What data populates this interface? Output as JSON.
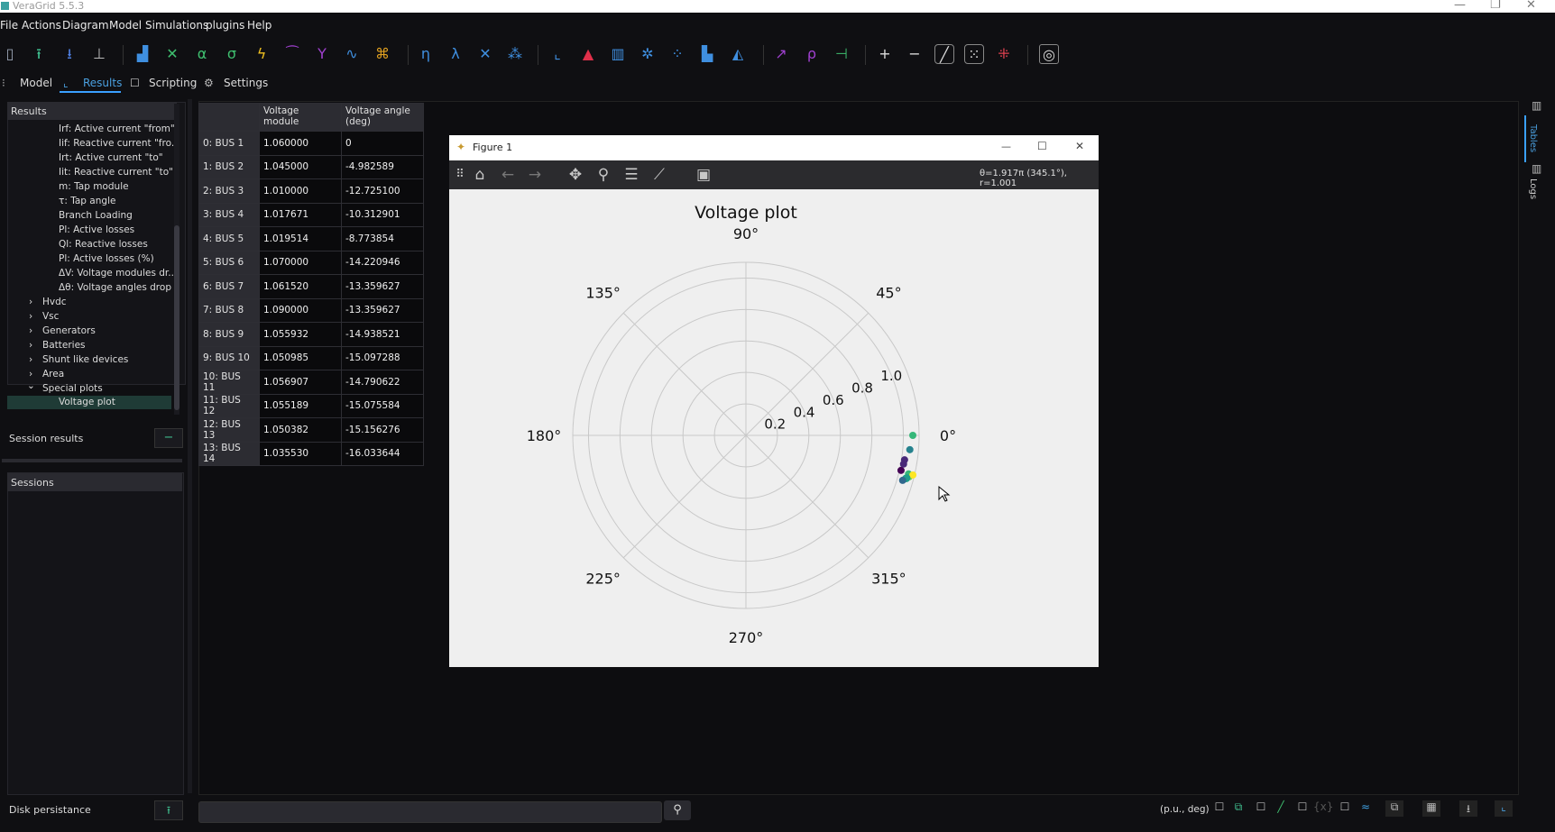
{
  "window": {
    "title": "VeraGrid 5.5.3"
  },
  "menu": [
    "File",
    "Actions",
    "Diagram",
    "Model",
    "Simulations",
    "plugins",
    "Help"
  ],
  "toolbar": {
    "icons": [
      "new-file-icon",
      "open-file-icon",
      "save-file-icon",
      "export-icon",
      "power-flow-icon",
      "short-circuit-icon",
      "alpha-icon",
      "sigma-icon",
      "lightning-icon",
      "curve-icon",
      "y-icon",
      "wave-icon",
      "bug-icon",
      "eta-icon",
      "lambda-icon",
      "network-icon",
      "cluster-icon",
      "chart-axis-icon",
      "triangle-icon",
      "bars-icon",
      "sparkle-icon",
      "scatter-icon",
      "bar-chart-icon",
      "area-chart-icon",
      "tool-1-icon",
      "tool-2-icon",
      "tool-3-icon",
      "zoom-in-icon",
      "zoom-out-icon",
      "slash-icon",
      "select-icon",
      "clear-icon",
      "screenshot-icon"
    ],
    "zoom_in": "+",
    "zoom_out": "−"
  },
  "tabs": [
    {
      "label": "Model",
      "icon": "model-icon"
    },
    {
      "label": "Results",
      "icon": "results-icon",
      "active": true
    },
    {
      "label": "Scripting",
      "icon": "scripting-icon"
    },
    {
      "label": "Settings",
      "icon": "gear-icon"
    }
  ],
  "results_panel": {
    "header": "Results",
    "items": [
      "Irf: Active current \"from\"",
      "Iif: Reactive current \"fro...",
      "Irt: Active current \"to\"",
      "Iit: Reactive current \"to\"",
      "m: Tap module",
      "τ: Tap angle",
      "Branch Loading",
      "Pl: Active losses",
      "Ql: Reactive losses",
      "Pl: Active losses (%)",
      "ΔV: Voltage modules dr...",
      "Δθ: Voltage angles drop"
    ],
    "groups": [
      "Hvdc",
      "Vsc",
      "Generators",
      "Batteries",
      "Shunt like devices",
      "Area"
    ],
    "open_group": "Special plots",
    "selected": "Voltage plot",
    "expand_glyph": "›",
    "open_glyph": "⌄"
  },
  "session_results": {
    "label": "Session results",
    "button": "−"
  },
  "sessions": {
    "label": "Sessions"
  },
  "disk": {
    "label": "Disk persistance",
    "button": "⭱"
  },
  "table": {
    "headers": [
      "Voltage module",
      "Voltage angle\n(deg)"
    ],
    "rows": [
      [
        "0: BUS 1",
        "1.060000",
        "0"
      ],
      [
        "1: BUS 2",
        "1.045000",
        "-4.982589"
      ],
      [
        "2: BUS 3",
        "1.010000",
        "-12.725100"
      ],
      [
        "3: BUS 4",
        "1.017671",
        "-10.312901"
      ],
      [
        "4: BUS 5",
        "1.019514",
        "-8.773854"
      ],
      [
        "5: BUS 6",
        "1.070000",
        "-14.220946"
      ],
      [
        "6: BUS 7",
        "1.061520",
        "-13.359627"
      ],
      [
        "7: BUS 8",
        "1.090000",
        "-13.359627"
      ],
      [
        "8: BUS 9",
        "1.055932",
        "-14.938521"
      ],
      [
        "9: BUS 10",
        "1.050985",
        "-15.097288"
      ],
      [
        "10: BUS 11",
        "1.056907",
        "-14.790622"
      ],
      [
        "11: BUS 12",
        "1.055189",
        "-15.075584"
      ],
      [
        "12: BUS 13",
        "1.050382",
        "-15.156276"
      ],
      [
        "13: BUS 14",
        "1.035530",
        "-16.033644"
      ]
    ]
  },
  "figure": {
    "window_title": "Figure 1",
    "coords_readout": "θ=1.917π (345.1°), r=1.001",
    "min_glyph": "—",
    "max_glyph": "☐",
    "close_glyph": "✕",
    "toolbar_icons": [
      "grip-icon",
      "home-icon",
      "back-icon",
      "forward-icon",
      "pan-icon",
      "zoom-icon",
      "configure-icon",
      "edit-axis-icon",
      "save-icon"
    ]
  },
  "chart_data": {
    "type": "scatter",
    "projection": "polar",
    "title": "Voltage plot",
    "angle_ticks": [
      "0°",
      "45°",
      "90°",
      "135°",
      "180°",
      "225°",
      "270°",
      "315°"
    ],
    "radial_ticks": [
      "0.2",
      "0.4",
      "0.6",
      "0.8",
      "1.0"
    ],
    "rlim": [
      0,
      1.1
    ],
    "grid": true,
    "colormap": "viridis",
    "points": [
      {
        "r": 1.06,
        "theta_deg": 0
      },
      {
        "r": 1.045,
        "theta_deg": -4.982589
      },
      {
        "r": 1.01,
        "theta_deg": -12.7251
      },
      {
        "r": 1.017671,
        "theta_deg": -10.312901
      },
      {
        "r": 1.019514,
        "theta_deg": -8.773854
      },
      {
        "r": 1.07,
        "theta_deg": -14.220946
      },
      {
        "r": 1.06152,
        "theta_deg": -13.359627
      },
      {
        "r": 1.09,
        "theta_deg": -13.359627
      },
      {
        "r": 1.055932,
        "theta_deg": -14.938521
      },
      {
        "r": 1.050985,
        "theta_deg": -15.097288
      },
      {
        "r": 1.056907,
        "theta_deg": -14.790622
      },
      {
        "r": 1.055189,
        "theta_deg": -15.075584
      },
      {
        "r": 1.050382,
        "theta_deg": -15.156276
      },
      {
        "r": 1.03553,
        "theta_deg": -16.033644
      }
    ]
  },
  "statusbar": {
    "search_placeholder": "",
    "units": "(p.u., deg)"
  },
  "right_dock": [
    "Tables",
    "Logs"
  ]
}
